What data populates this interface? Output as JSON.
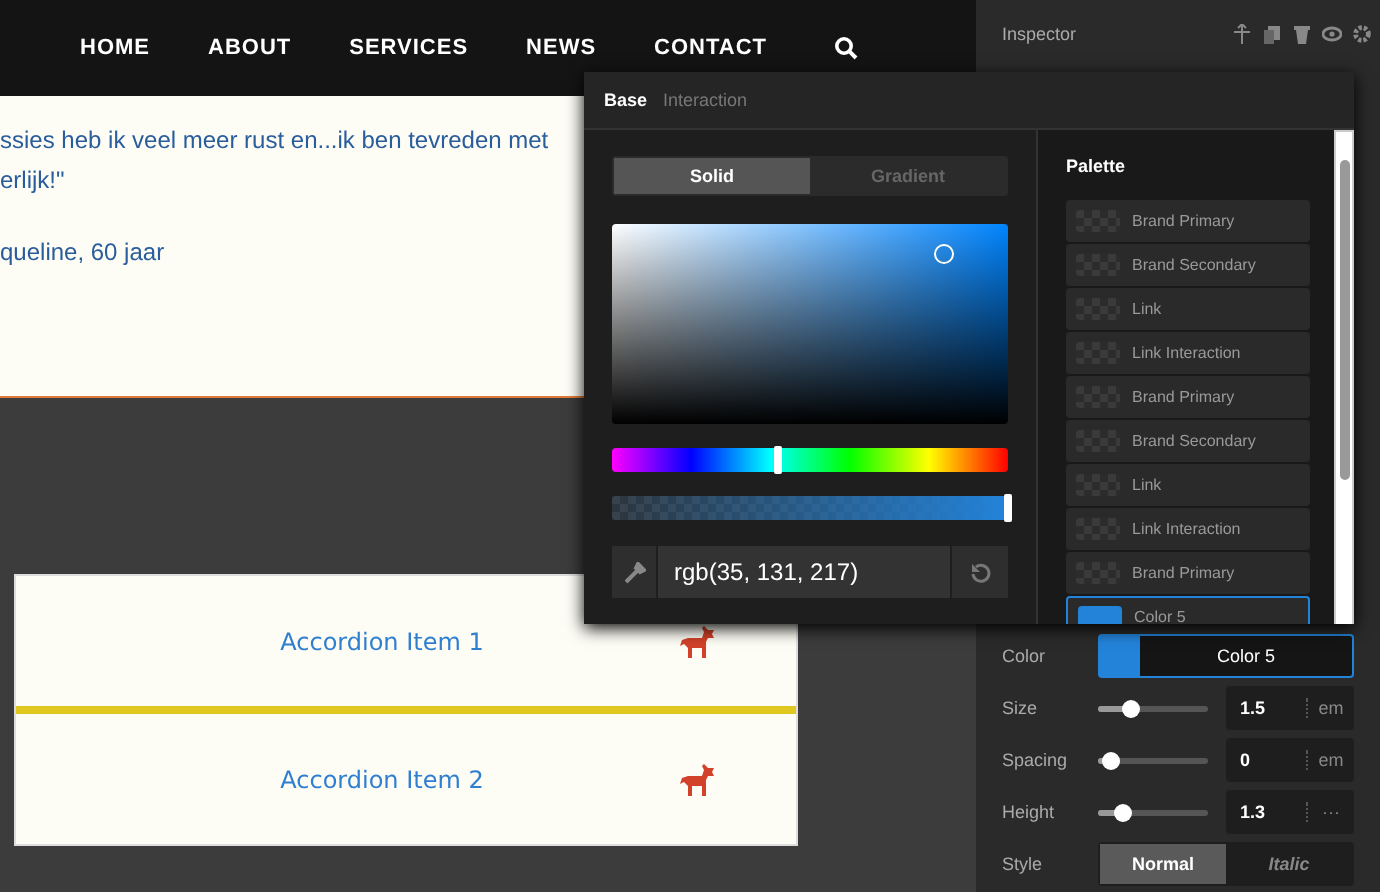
{
  "nav": {
    "items": [
      {
        "label": "HOME"
      },
      {
        "label": "ABOUT"
      },
      {
        "label": "SERVICES"
      },
      {
        "label": "NEWS"
      },
      {
        "label": "CONTACT"
      }
    ]
  },
  "quote": {
    "lines": [
      "ssies heb ik veel meer rust en...ik ben tevreden met",
      "erlijk!\""
    ],
    "author": "queline, 60 jaar"
  },
  "accordion": {
    "items": [
      {
        "label": "Accordion Item 1"
      },
      {
        "label": "Accordion Item 2"
      }
    ]
  },
  "inspector": {
    "title": "Inspector",
    "color": {
      "label": "Color",
      "value": "Color 5",
      "color": "#2383d9"
    },
    "sliders": [
      {
        "label": "Size",
        "level": 0.29,
        "value": "1.5",
        "unit": "em"
      },
      {
        "label": "Spacing",
        "level": 0.1,
        "value": "0",
        "unit": "em"
      },
      {
        "label": "Height",
        "level": 0.22,
        "value": "1.3",
        "unit": "···"
      }
    ],
    "style": {
      "label": "Style",
      "options": [
        {
          "label": "Normal",
          "selected": true
        },
        {
          "label": "Italic",
          "selected": false
        }
      ]
    }
  },
  "color_picker": {
    "tabs": [
      {
        "label": "Base",
        "selected": true
      },
      {
        "label": "Interaction",
        "selected": false
      }
    ],
    "modes": [
      {
        "label": "Solid",
        "selected": true
      },
      {
        "label": "Gradient",
        "selected": false
      }
    ],
    "hue": {
      "level": 0.42
    },
    "alpha": {
      "level": 1
    },
    "value": "rgb(35, 131, 217)",
    "palette_title": "Palette",
    "palette": [
      {
        "label": "Brand Primary",
        "selected": false
      },
      {
        "label": "Brand Secondary",
        "selected": false
      },
      {
        "label": "Link",
        "selected": false
      },
      {
        "label": "Link Interaction",
        "selected": false
      },
      {
        "label": "Brand Primary",
        "selected": false
      },
      {
        "label": "Brand Secondary",
        "selected": false
      },
      {
        "label": "Link",
        "selected": false
      },
      {
        "label": "Link Interaction",
        "selected": false
      },
      {
        "label": "Brand Primary",
        "selected": false
      },
      {
        "label": "Color 5",
        "selected": true,
        "color": "#2383d9"
      }
    ]
  }
}
